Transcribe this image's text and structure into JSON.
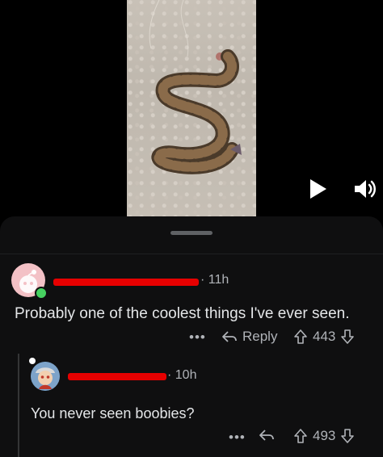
{
  "comments": [
    {
      "time": "11h",
      "body": "Probably one of the coolest things I've ever seen.",
      "reply_label": "Reply",
      "votes": "443",
      "more": "•••"
    },
    {
      "time": "10h",
      "body": "You never seen boobies?",
      "votes": "493",
      "more": "•••"
    }
  ],
  "icons": {
    "play": "play-icon",
    "volume": "volume-icon",
    "reply": "reply-arrow-icon",
    "upvote": "upvote-arrow-icon",
    "downvote": "downvote-arrow-icon"
  },
  "colors": {
    "background": "#000000",
    "sheet": "#0f0f10",
    "text": "#e4e6e8",
    "muted": "#b0b3b8",
    "redaction": "#e60000",
    "online": "#46d160"
  }
}
